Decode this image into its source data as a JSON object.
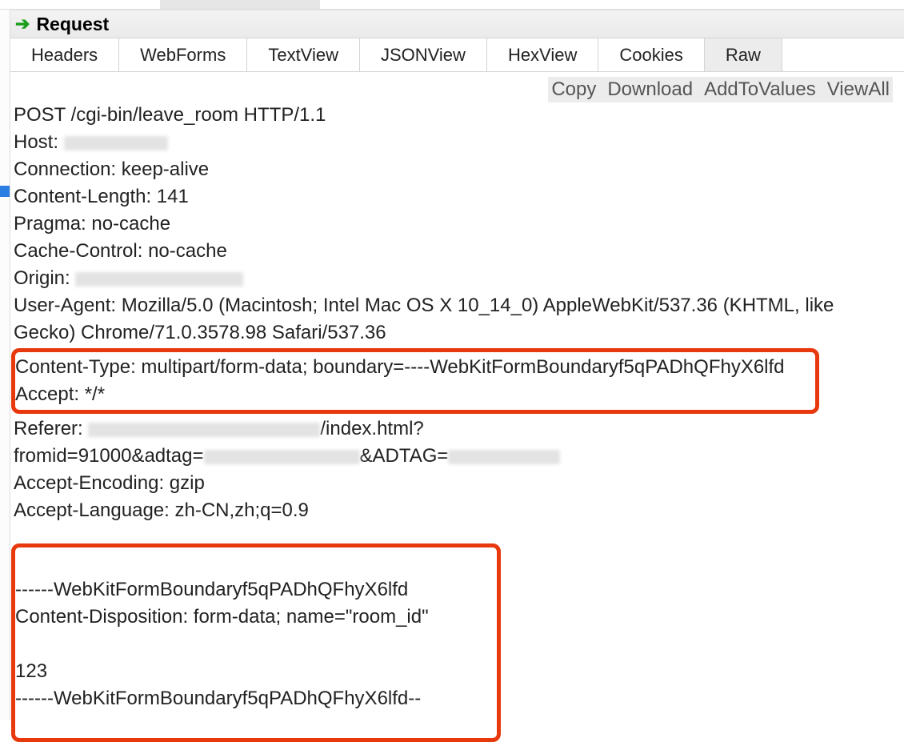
{
  "header": {
    "title": "Request"
  },
  "tabs": {
    "items": [
      {
        "label": "Headers",
        "active": false
      },
      {
        "label": "WebForms",
        "active": false
      },
      {
        "label": "TextView",
        "active": false
      },
      {
        "label": "JSONView",
        "active": false
      },
      {
        "label": "HexView",
        "active": false
      },
      {
        "label": "Cookies",
        "active": false
      },
      {
        "label": "Raw",
        "active": true
      }
    ]
  },
  "actions": {
    "copy": "Copy",
    "download": "Download",
    "add_to_values": "AddToValues",
    "view_all": "ViewAll"
  },
  "raw": {
    "request_line": "POST /cgi-bin/leave_room HTTP/1.1",
    "host_label": "Host: ",
    "connection": "Connection: keep-alive",
    "content_length": "Content-Length: 141",
    "pragma": "Pragma: no-cache",
    "cache_control": "Cache-Control: no-cache",
    "origin_label": "Origin: ",
    "user_agent": "User-Agent: Mozilla/5.0 (Macintosh; Intel Mac OS X 10_14_0) AppleWebKit/537.36 (KHTML, like Gecko) Chrome/71.0.3578.98 Safari/537.36",
    "content_type": "Content-Type: multipart/form-data; boundary=----WebKitFormBoundaryf5qPADhQFhyX6lfd",
    "accept": "Accept: */*",
    "referer_label": "Referer: ",
    "referer_tail": "/index.html?",
    "referer_line2_pre": "fromid=91000&adtag=",
    "referer_line2_mid": "&ADTAG=",
    "accept_encoding": "Accept-Encoding: gzip",
    "accept_language": "Accept-Language: zh-CN,zh;q=0.9",
    "body_boundary_open": "------WebKitFormBoundaryf5qPADhQFhyX6lfd",
    "body_disposition": "Content-Disposition: form-data; name=\"room_id\"",
    "body_value": "123",
    "body_boundary_close": "------WebKitFormBoundaryf5qPADhQFhyX6lfd--"
  }
}
